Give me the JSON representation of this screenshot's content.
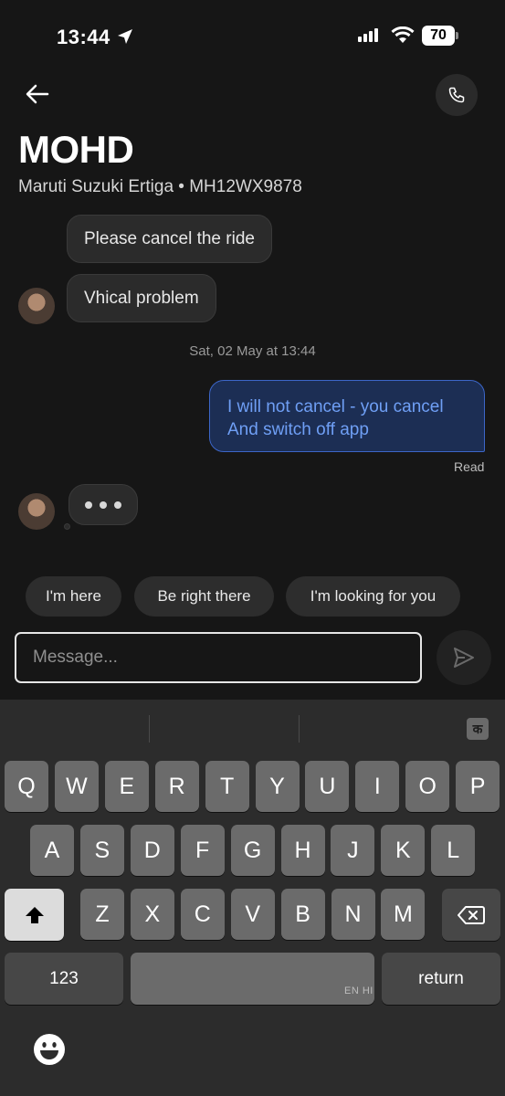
{
  "status_bar": {
    "time": "13:44",
    "battery": "70"
  },
  "header": {
    "contact_name": "MOHD",
    "vehicle": "Maruti Suzuki Ertiga • MH12WX9878"
  },
  "messages": {
    "incoming_1": "Please cancel the ride",
    "incoming_2": "Vhical problem",
    "timestamp": "Sat, 02 May at 13:44",
    "outgoing_line1": "I will not cancel - you cancel",
    "outgoing_line2": "And switch off app",
    "read_receipt": "Read"
  },
  "quick_replies": [
    "I'm here",
    "Be right there",
    "I'm looking for you"
  ],
  "composer": {
    "placeholder": "Message..."
  },
  "keyboard": {
    "row1": [
      "Q",
      "W",
      "E",
      "R",
      "T",
      "Y",
      "U",
      "I",
      "O",
      "P"
    ],
    "row2": [
      "A",
      "S",
      "D",
      "F",
      "G",
      "H",
      "J",
      "K",
      "L"
    ],
    "row3": [
      "Z",
      "X",
      "C",
      "V",
      "B",
      "N",
      "M"
    ],
    "numbers_label": "123",
    "return_label": "return",
    "space_label": "EN HI",
    "lang_switch": "क"
  },
  "colors": {
    "accent_blue": "#6f9ff5",
    "outgoing_bg": "#1c2e54",
    "background": "#161616"
  }
}
